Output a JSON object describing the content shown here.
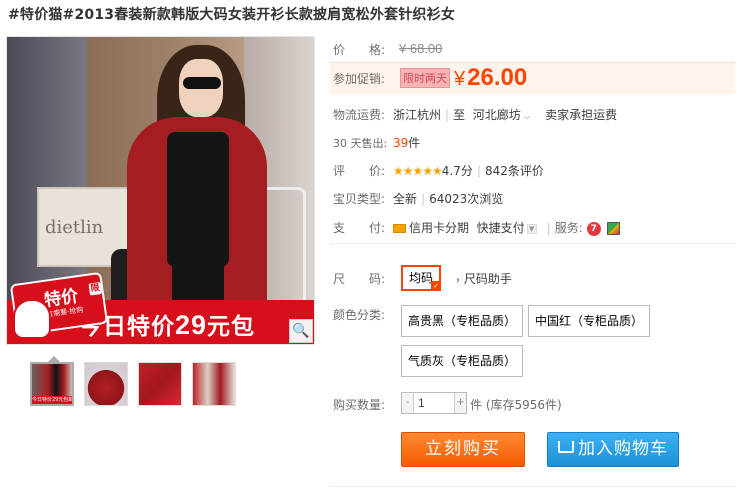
{
  "product": {
    "title": "#特价猫#2013春装新款韩版大码女装开衫长款披肩宽松外套针织衫女"
  },
  "image": {
    "sign_text": "dietlin",
    "promo_badge": "特价",
    "promo_badge_small": "限",
    "promo_badge_sub": "有需要·抢购",
    "promo_text_prefix": "今日特价",
    "promo_text_number": "29",
    "promo_text_suffix": "元包",
    "zoom_icon": "magnifier-icon",
    "thumb_mini": "今日特价29元包邮"
  },
  "price": {
    "label": "价　　格:",
    "original": "¥ 68.00",
    "promo_label": "参加促销:",
    "limited_tag": "限时两天",
    "currency": "¥",
    "current": "26.00"
  },
  "shipping": {
    "label": "物流运费:",
    "from": "浙江杭州",
    "to_word": "至",
    "to": "河北廊坊",
    "fee": "卖家承担运费"
  },
  "sales": {
    "label": "30 天售出:",
    "count": "39",
    "unit": "件"
  },
  "rating": {
    "label": "评　　价:",
    "stars": "★★★★★",
    "score": "4.7分",
    "reviews": "842条评价"
  },
  "type": {
    "label": "宝贝类型:",
    "value": "全新",
    "views": "64023次浏览"
  },
  "payment": {
    "label": "支　　付:",
    "credit": "信用卡分期",
    "quick": "快捷支付",
    "service_label": "服务:",
    "service_icon_1": "7"
  },
  "size": {
    "label": "尺　　码:",
    "option": "均码",
    "helper": "尺码助手"
  },
  "color": {
    "label": "颜色分类:",
    "options": [
      "高贵黑（专柜品质）",
      "中国红（专柜品质）",
      "气质灰（专柜品质）"
    ]
  },
  "quantity": {
    "label": "购买数量:",
    "minus": "-",
    "plus": "+",
    "value": "1",
    "stock": "件 (库存5956件)"
  },
  "actions": {
    "buy": "立刻购买",
    "cart": "加入购物车"
  },
  "colors": {
    "accent": "#ff4400",
    "promo_red": "#d60f1a",
    "buy_orange": "#f55b00",
    "cart_blue": "#1f91d8"
  }
}
